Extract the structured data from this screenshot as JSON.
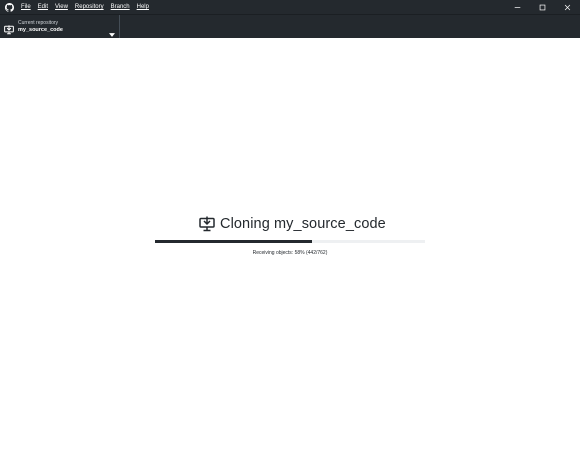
{
  "menu": {
    "items": [
      {
        "label": "File"
      },
      {
        "label": "Edit"
      },
      {
        "label": "View"
      },
      {
        "label": "Repository"
      },
      {
        "label": "Branch"
      },
      {
        "label": "Help"
      }
    ]
  },
  "window_controls": {
    "minimize_icon": "minimize-icon",
    "maximize_icon": "maximize-icon",
    "close_icon": "close-icon"
  },
  "toolbar": {
    "repo_caption": "Current repository",
    "repo_name": "my_source_code",
    "repo_icon": "repository-download-icon",
    "chevron_icon": "chevron-down-icon"
  },
  "clone": {
    "title": "Cloning my_source_code",
    "icon": "repository-download-icon",
    "progress_text": "Receiving objects: 58% (442/762)",
    "progress_fraction": 0.58
  },
  "colors": {
    "chrome": "#24292e",
    "progress_fill": "#24292e",
    "progress_track": "#eef0f2",
    "background": "#ffffff"
  }
}
